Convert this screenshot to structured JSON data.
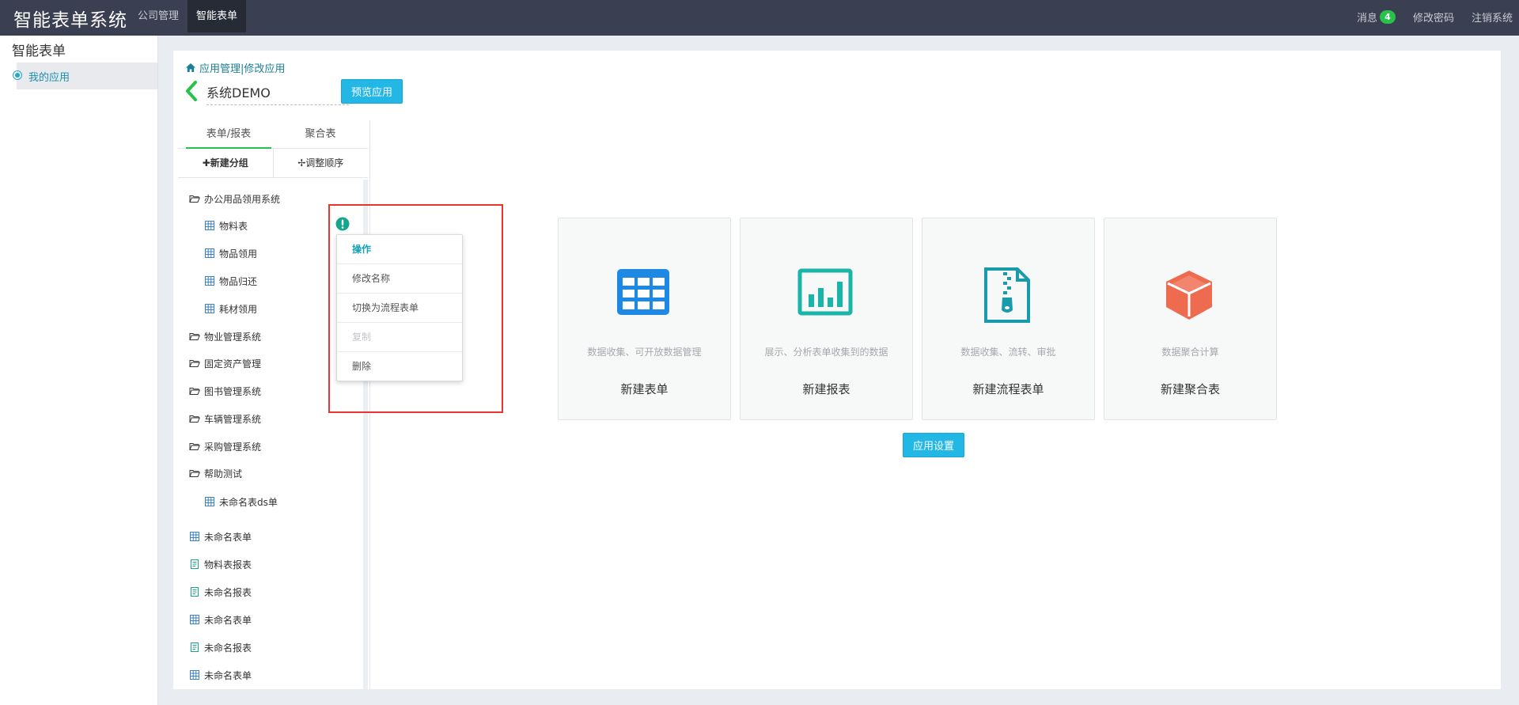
{
  "header": {
    "brand": "智能表单系统",
    "nav": [
      "公司管理",
      "智能表单"
    ],
    "messages_label": "消息",
    "messages_count": "4",
    "change_password": "修改密码",
    "logout": "注销系统"
  },
  "sidebar": {
    "title": "智能表单",
    "items": [
      {
        "label": "我的应用"
      }
    ]
  },
  "main": {
    "breadcrumb": "应用管理|修改应用",
    "app_name": "系统DEMO",
    "preview_button": "预览应用",
    "tabs": [
      "表单/报表",
      "聚合表"
    ],
    "tools": [
      "新建分组",
      "调整顺序"
    ],
    "tree": [
      {
        "label": "办公用品领用系统",
        "type": "folder"
      },
      {
        "label": "物料表",
        "type": "form"
      },
      {
        "label": "物品领用",
        "type": "form"
      },
      {
        "label": "物品归还",
        "type": "form"
      },
      {
        "label": "耗材领用",
        "type": "form"
      },
      {
        "label": "物业管理系统",
        "type": "folder"
      },
      {
        "label": "固定资产管理",
        "type": "folder"
      },
      {
        "label": "图书管理系统",
        "type": "folder"
      },
      {
        "label": "车辆管理系统",
        "type": "folder"
      },
      {
        "label": "采购管理系统",
        "type": "folder"
      },
      {
        "label": "帮助测试",
        "type": "folder"
      },
      {
        "label": "未命名表ds单",
        "type": "form"
      },
      {
        "label": "未命名表单",
        "type": "form"
      },
      {
        "label": "物料表报表",
        "type": "report"
      },
      {
        "label": "未命名报表",
        "type": "report"
      },
      {
        "label": "未命名表单",
        "type": "form"
      },
      {
        "label": "未命名报表",
        "type": "report"
      },
      {
        "label": "未命名表单",
        "type": "form"
      }
    ],
    "context_menu": {
      "header": "操作",
      "items": [
        "修改名称",
        "切换为流程表单",
        "复制",
        "删除"
      ]
    },
    "cards": [
      {
        "desc": "数据收集、可开放数据管理",
        "title": "新建表单",
        "icon": "table-icon",
        "color": "#1e88e5"
      },
      {
        "desc": "展示、分析表单收集到的数据",
        "title": "新建报表",
        "icon": "bar-chart-icon",
        "color": "#1ab4a8"
      },
      {
        "desc": "数据收集、流转、审批",
        "title": "新建流程表单",
        "icon": "zip-file-icon",
        "color": "#1a9bab"
      },
      {
        "desc": "数据聚合计算",
        "title": "新建聚合表",
        "icon": "cube-icon",
        "color": "#ef6b4f"
      }
    ],
    "settings_button": "应用设置"
  }
}
